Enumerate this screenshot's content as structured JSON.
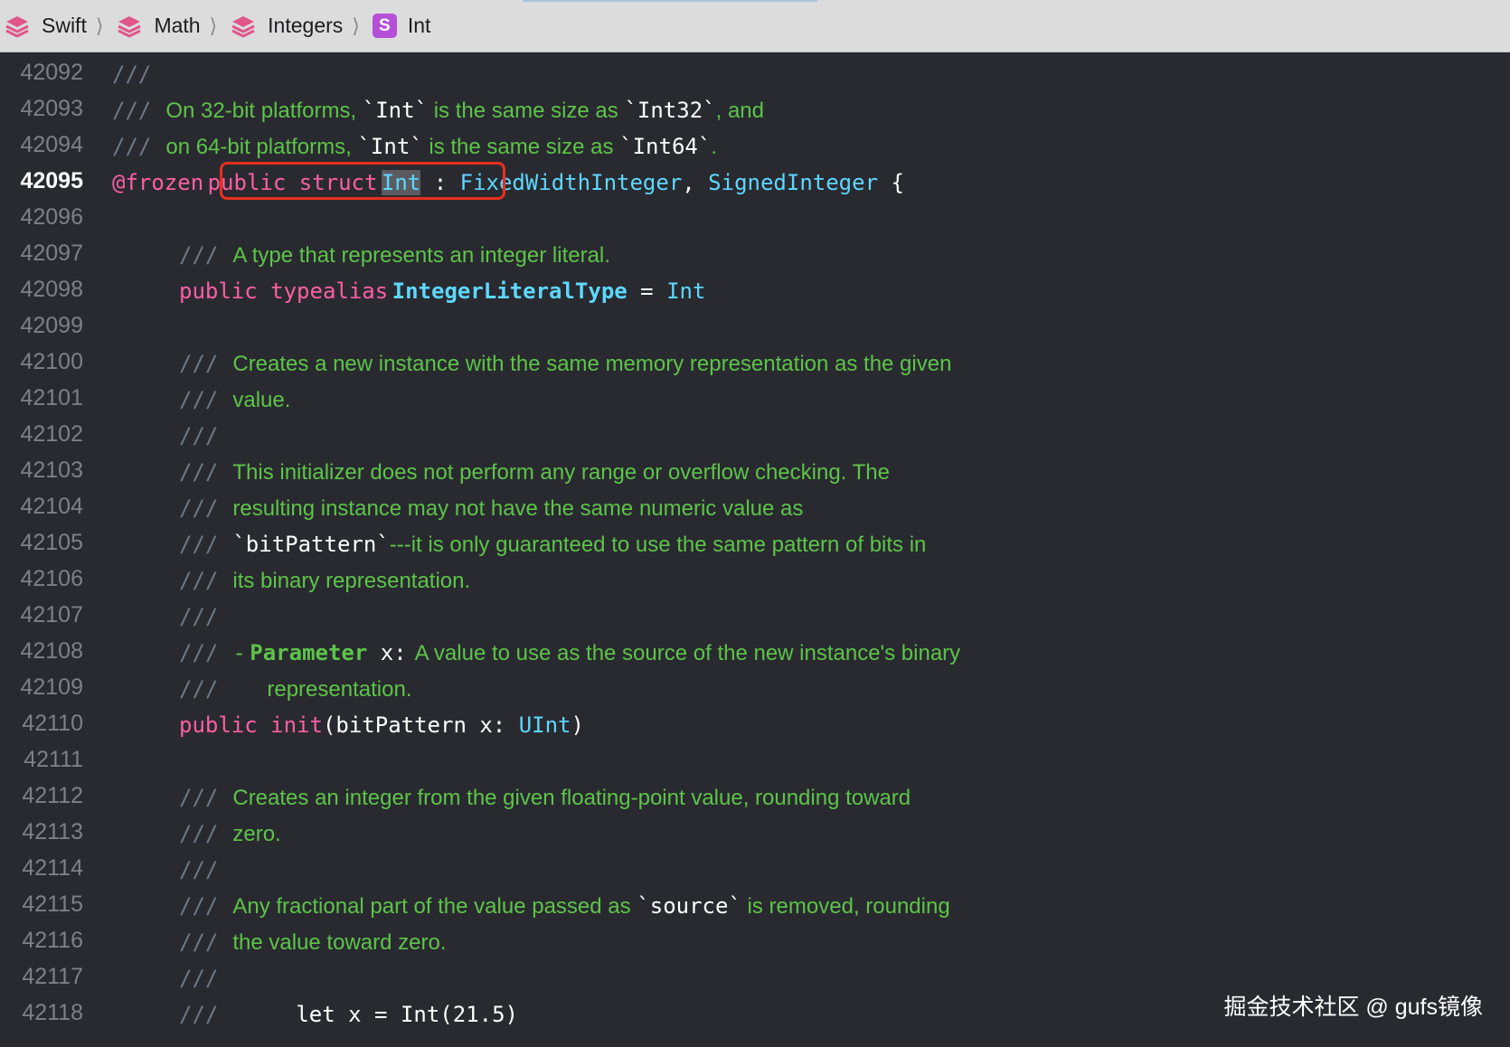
{
  "breadcrumb": {
    "items": [
      {
        "label": "Swift",
        "icon": "framework-stack-icon"
      },
      {
        "label": "Math",
        "icon": "framework-stack-icon"
      },
      {
        "label": "Integers",
        "icon": "framework-stack-icon"
      },
      {
        "label": "Int",
        "icon": "struct-s-icon"
      }
    ],
    "separator": "⟩",
    "struct_badge": "S"
  },
  "editor": {
    "current_line": "42095",
    "lines": [
      {
        "num": "42092",
        "c1": "///"
      },
      {
        "num": "42093",
        "c1": "///",
        "c2": "On 32-bit platforms, ",
        "c3": "`Int`",
        "c4": " is the same size as ",
        "c5": "`Int32`",
        "c6": ", and"
      },
      {
        "num": "42094",
        "c1": "///",
        "c2": "on 64-bit platforms, ",
        "c3": "`Int`",
        "c4": " is the same size as ",
        "c5": "`Int64`",
        "c6": "."
      },
      {
        "num": "42095",
        "attr": "@frozen",
        "kw": "public struct",
        "name": "Int",
        "colon": " : ",
        "t1": "FixedWidthInteger",
        "comma": ", ",
        "t2": "SignedInteger",
        "brace": " {"
      },
      {
        "num": "42096"
      },
      {
        "num": "42097",
        "c1": "///",
        "c2": "A type that represents an integer literal."
      },
      {
        "num": "42098",
        "kw": "public typealias",
        "name": "IntegerLiteralType",
        "eq": " = ",
        "t1": "Int"
      },
      {
        "num": "42099"
      },
      {
        "num": "42100",
        "c1": "///",
        "c2": "Creates a new instance with the same memory representation as the given"
      },
      {
        "num": "42101",
        "c1": "///",
        "c2": "value."
      },
      {
        "num": "42102",
        "c1": "///"
      },
      {
        "num": "42103",
        "c1": "///",
        "c2": "This initializer does not perform any range or overflow checking. The"
      },
      {
        "num": "42104",
        "c1": "///",
        "c2": "resulting instance may not have the same numeric value as"
      },
      {
        "num": "42105",
        "c1": "///",
        "c3": "`bitPattern`",
        "c4": "---it is only guaranteed to use the same pattern of bits in"
      },
      {
        "num": "42106",
        "c1": "///",
        "c2": "its binary representation."
      },
      {
        "num": "42107",
        "c1": "///"
      },
      {
        "num": "42108",
        "c1": "///",
        "dash": "-",
        "param": "Parameter",
        "px": " x:",
        "c2": "A value to use as the source of the new instance's binary"
      },
      {
        "num": "42109",
        "c1": "///",
        "c2": "representation."
      },
      {
        "num": "42110",
        "kw": "public init",
        "p1": "(bitPattern x: ",
        "t1": "UInt",
        "p2": ")"
      },
      {
        "num": "42111"
      },
      {
        "num": "42112",
        "c1": "///",
        "c2": "Creates an integer from the given floating-point value, rounding toward"
      },
      {
        "num": "42113",
        "c1": "///",
        "c2": "zero."
      },
      {
        "num": "42114",
        "c1": "///"
      },
      {
        "num": "42115",
        "c1": "///",
        "c2": "Any fractional part of the value passed as ",
        "c3": "`source`",
        "c4": " is removed, rounding"
      },
      {
        "num": "42116",
        "c1": "///",
        "c2": "the value toward zero."
      },
      {
        "num": "42117",
        "c1": "///"
      },
      {
        "num": "42118",
        "c1": "///",
        "code": "let x = Int(21.5)"
      }
    ]
  },
  "watermark": "掘金技术社区 @ gufs镜像",
  "colors": {
    "background": "#292a30",
    "comment": "#5dc448",
    "keyword": "#fc5fa3",
    "type": "#5dd8ff",
    "annotation_box": "#e8301e"
  }
}
